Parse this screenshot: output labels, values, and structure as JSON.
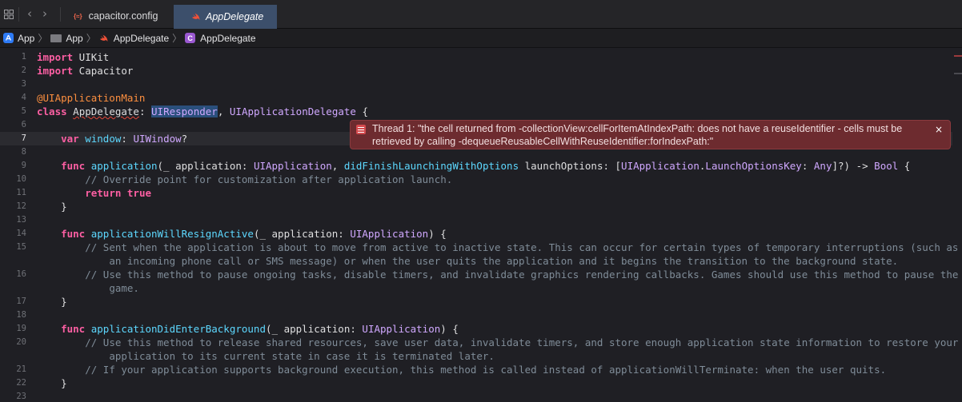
{
  "tabs": [
    {
      "label": "capacitor.config",
      "icon": "json-icon"
    },
    {
      "label": "AppDelegate",
      "icon": "swift-icon",
      "active": true
    }
  ],
  "breadcrumb": [
    "App",
    "App",
    "AppDelegate",
    "AppDelegate"
  ],
  "lines": [
    {
      "n": "1"
    },
    {
      "n": "2"
    },
    {
      "n": "3"
    },
    {
      "n": "4"
    },
    {
      "n": "5"
    },
    {
      "n": "6"
    },
    {
      "n": "7"
    },
    {
      "n": "8"
    },
    {
      "n": "9"
    },
    {
      "n": "10"
    },
    {
      "n": "11"
    },
    {
      "n": "12"
    },
    {
      "n": "13"
    },
    {
      "n": "14"
    },
    {
      "n": "15"
    },
    {
      "n": "16"
    },
    {
      "n": "17"
    },
    {
      "n": "18"
    },
    {
      "n": "19"
    },
    {
      "n": "20"
    },
    {
      "n": "21"
    },
    {
      "n": "22"
    }
  ],
  "code": {
    "l1_kw": "import",
    "l1_rest": " UIKit",
    "l2_kw": "import",
    "l2_rest": " Capacitor",
    "l4_attr": "@UIApplicationMain",
    "l5_kw": "class",
    "l5_name": "AppDelegate",
    "l5_colon": ": ",
    "l5_t1": "UIResponder",
    "l5_comma": ", ",
    "l5_t2": "UIApplicationDelegate",
    "l5_brace": " {",
    "l7_kw": "var",
    "l7_name": " window",
    "l7_colon": ": ",
    "l7_type": "UIWindow",
    "l7_q": "?",
    "l9_kw": "func",
    "l9_fn": " application",
    "l9_a": "(_ application: ",
    "l9_t1": "UIApplication",
    "l9_b": ", ",
    "l9_lbl": "didFinishLaunchingWithOptions",
    "l9_c": " launchOptions: [",
    "l9_t2": "UIApplication",
    "l9_d": ".",
    "l9_t3": "LaunchOptionsKey",
    "l9_e": ": ",
    "l9_t4": "Any",
    "l9_f": "]?) -> ",
    "l9_t5": "Bool",
    "l9_g": " {",
    "l10_cm": "// Override point for customization after application launch.",
    "l11_kw": "return",
    "l11_kw2": " true",
    "l12": "}",
    "l14_kw": "func",
    "l14_fn": " applicationWillResignActive",
    "l14_a": "(_ application: ",
    "l14_t": "UIApplication",
    "l14_b": ") {",
    "l15_cm": "// Sent when the application is about to move from active to inactive state. This can occur for certain types of temporary interruptions (such as",
    "l15b_cm": "an incoming phone call or SMS message) or when the user quits the application and it begins the transition to the background state.",
    "l16_cm": "// Use this method to pause ongoing tasks, disable timers, and invalidate graphics rendering callbacks. Games should use this method to pause the",
    "l16b_cm": "game.",
    "l17": "}",
    "l19_kw": "func",
    "l19_fn": " applicationDidEnterBackground",
    "l19_a": "(_ application: ",
    "l19_t": "UIApplication",
    "l19_b": ") {",
    "l20_cm": "// Use this method to release shared resources, save user data, invalidate timers, and store enough application state information to restore your",
    "l20b_cm": "application to its current state in case it is terminated later.",
    "l21_cm": "// If your application supports background execution, this method is called instead of applicationWillTerminate: when the user quits.",
    "l22": "}"
  },
  "error": {
    "line1": "Thread 1: \"the cell returned from -collectionView:cellForItemAtIndexPath: does not have a reuseIdentifier - cells must be",
    "line2": "retrieved by calling -dequeueReusableCellWithReuseIdentifier:forIndexPath:\"",
    "close": "×"
  },
  "colors": {
    "keyword": "#fc5fa3",
    "type": "#d0a8ff",
    "function": "#67b7a4",
    "attribute": "#fd8f3f",
    "comment": "#7f8c98",
    "error_bg": "#6d2b2f",
    "active_tab": "#3c4f6b"
  }
}
